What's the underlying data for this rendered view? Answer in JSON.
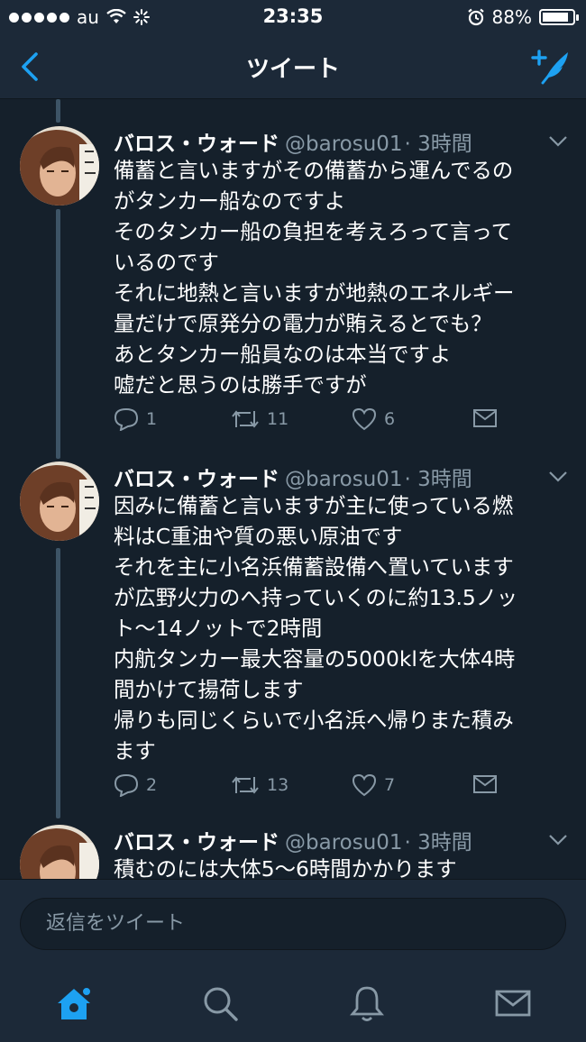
{
  "status": {
    "carrier": "au",
    "time": "23:35",
    "battery": "88%",
    "battery_level": 0.88
  },
  "nav": {
    "title": "ツイート",
    "back_icon": "chevron-left-icon",
    "compose_icon": "compose-tweet-icon"
  },
  "colors": {
    "background": "#15202b",
    "bar": "#1c2938",
    "accent": "#1da1f2",
    "secondary_text": "#8899a6"
  },
  "tweets": [
    {
      "name": "バロス・ウォード",
      "handle": "@barosu01",
      "time": "· 3時間",
      "lines": [
        "備蓄と言いますがその備蓄から運んでるの",
        "がタンカー船なのですよ",
        "そのタンカー船の負担を考えろって言って",
        "いるのです",
        "それに地熱と言いますが地熱のエネルギー",
        "量だけで原発分の電力が賄えるとでも？",
        "あとタンカー船員なのは本当ですよ",
        "嘘だと思うのは勝手ですが"
      ],
      "replies": "1",
      "retweets": "11",
      "likes": "6"
    },
    {
      "name": "バロス・ウォード",
      "handle": "@barosu01",
      "time": "· 3時間",
      "lines": [
        "因みに備蓄と言いますが主に使っている燃",
        "料はC重油や質の悪い原油です",
        "それを主に小名浜備蓄設備へ置いています",
        "が広野火力のへ持っていくのに約13.5ノッ",
        "ト～14ノットで2時間",
        "内航タンカー最大容量の5000klを大体4時",
        "間かけて揚荷します",
        "帰りも同じくらいで小名浜へ帰りまた積み",
        "ます"
      ],
      "replies": "2",
      "retweets": "13",
      "likes": "7"
    },
    {
      "name": "バロス・ウォード",
      "handle": "@barosu01",
      "time": "· 3時間",
      "lines": [
        "積むのには大体5～6時間かかります"
      ]
    }
  ],
  "reply": {
    "placeholder": "返信をツイート"
  },
  "tabs": [
    {
      "icon": "home-icon",
      "active": true
    },
    {
      "icon": "search-icon",
      "active": false
    },
    {
      "icon": "notifications-bell-icon",
      "active": false
    },
    {
      "icon": "messages-envelope-icon",
      "active": false
    }
  ]
}
